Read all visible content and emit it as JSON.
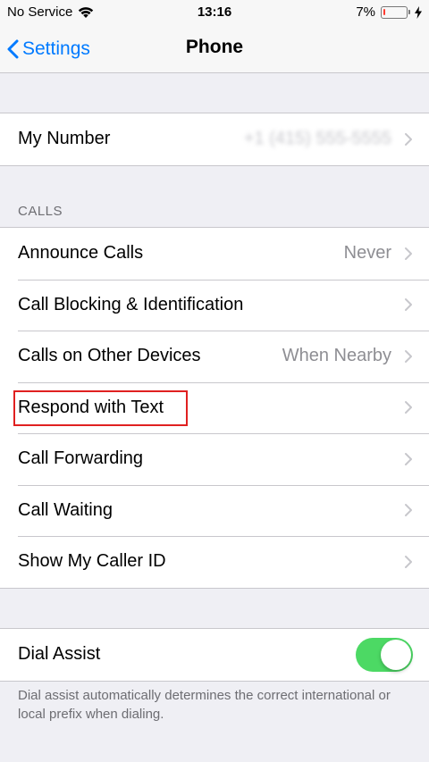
{
  "status_bar": {
    "carrier": "No Service",
    "time": "13:16",
    "battery_percent": "7%",
    "battery_level": 0.07,
    "battery_color": "#ff3b30"
  },
  "nav": {
    "back_label": "Settings",
    "title": "Phone"
  },
  "my_number": {
    "label": "My Number",
    "value_blurred": "+1 (415) 555-5555"
  },
  "calls_section": {
    "header": "CALLS",
    "items": [
      {
        "label": "Announce Calls",
        "value": "Never"
      },
      {
        "label": "Call Blocking & Identification",
        "value": ""
      },
      {
        "label": "Calls on Other Devices",
        "value": "When Nearby"
      },
      {
        "label": "Respond with Text",
        "value": ""
      },
      {
        "label": "Call Forwarding",
        "value": ""
      },
      {
        "label": "Call Waiting",
        "value": ""
      },
      {
        "label": "Show My Caller ID",
        "value": ""
      }
    ]
  },
  "dial_assist": {
    "label": "Dial Assist",
    "enabled": true,
    "toggle_color": "#4cd964",
    "footer": "Dial assist automatically determines the correct international or local prefix when dialing."
  },
  "accent_color": "#007aff"
}
